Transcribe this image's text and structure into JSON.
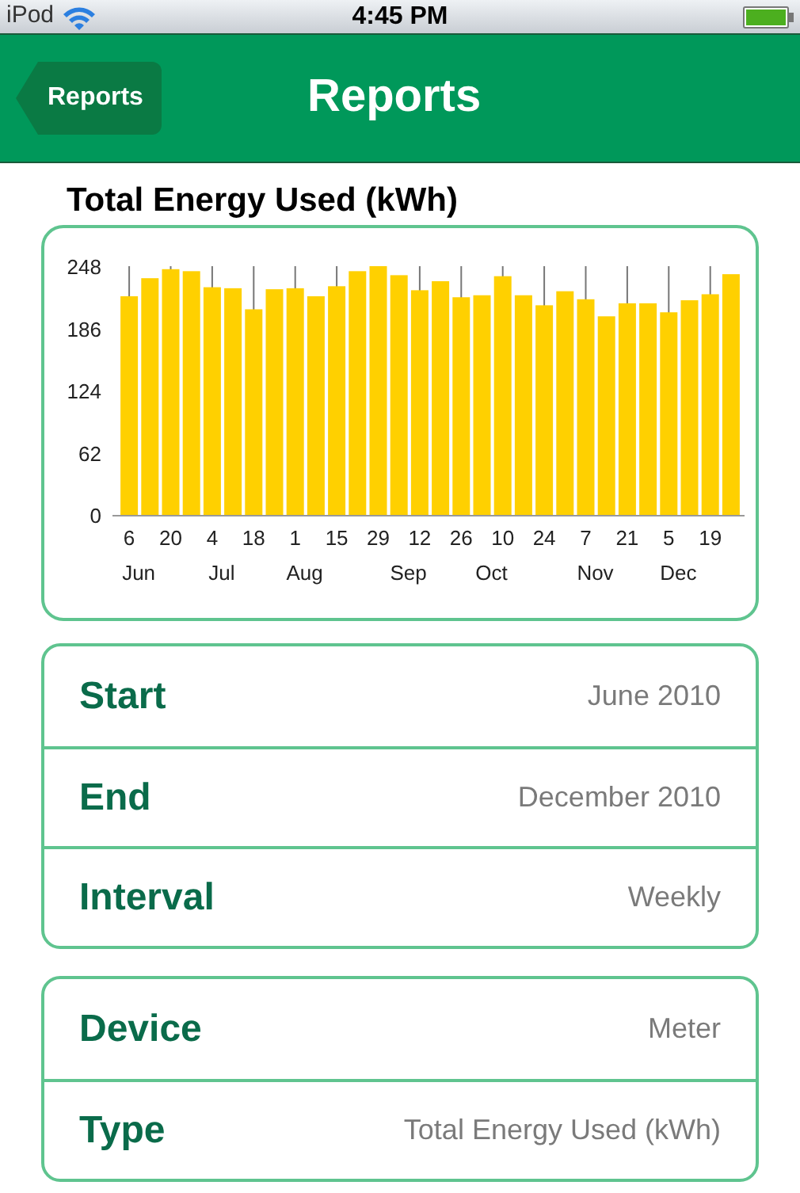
{
  "status_bar": {
    "carrier": "iPod",
    "time": "4:45 PM"
  },
  "nav_bar": {
    "back_button": "Reports",
    "title": "Reports"
  },
  "chart": {
    "title": "Total Energy Used (kWh)",
    "chart_data": {
      "type": "bar",
      "categories": [
        "6",
        null,
        "20",
        null,
        "4",
        null,
        "18",
        null,
        "1",
        null,
        "15",
        null,
        "29",
        null,
        "12",
        null,
        "26",
        null,
        "10",
        null,
        "24",
        null,
        "7",
        null,
        "21",
        null,
        "5",
        null,
        "19",
        null
      ],
      "series": [
        {
          "color": "#ffd000",
          "values": [
            218,
            236,
            245,
            243,
            227,
            226,
            205,
            225,
            226,
            218,
            228,
            243,
            248,
            239,
            224,
            233,
            217,
            219,
            238,
            219,
            209,
            223,
            215,
            198,
            211,
            211,
            202,
            214,
            220,
            240
          ]
        }
      ],
      "ylim": [
        0,
        248
      ],
      "yticks": [
        0,
        62,
        124,
        186,
        248
      ],
      "grid": true
    },
    "month_labels": [
      "Jun",
      "Jul",
      "Aug",
      "Sep",
      "Oct",
      "Nov",
      "Dec"
    ]
  },
  "groups": [
    [
      {
        "label": "Start",
        "value": "June 2010"
      },
      {
        "label": "End",
        "value": "December 2010"
      },
      {
        "label": "Interval",
        "value": "Weekly"
      }
    ],
    [
      {
        "label": "Device",
        "value": "Meter"
      },
      {
        "label": "Type",
        "value": "Total Energy Used (kWh)"
      }
    ]
  ]
}
